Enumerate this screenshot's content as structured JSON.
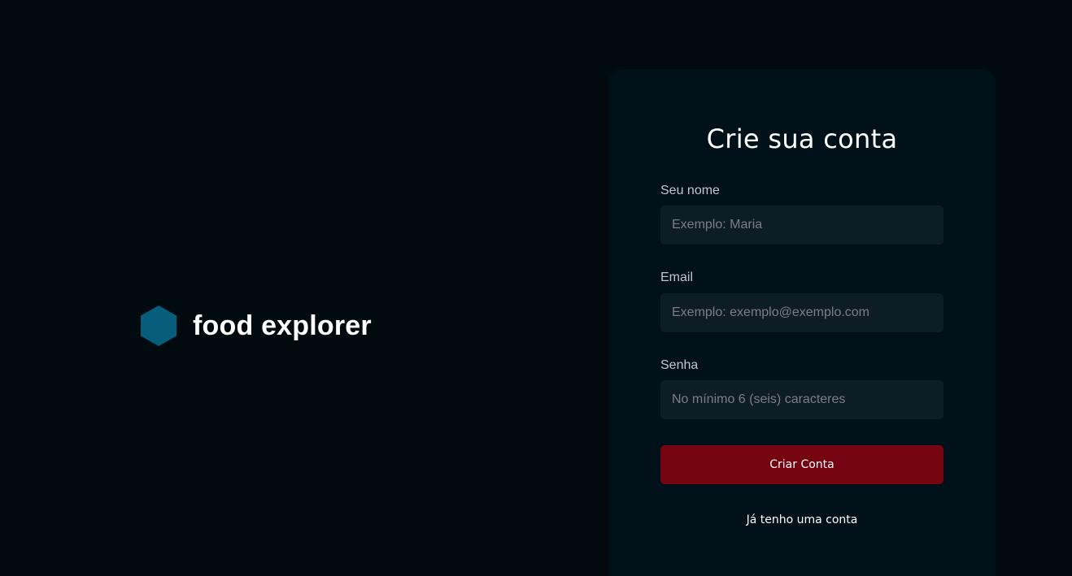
{
  "brand": {
    "name": "food explorer",
    "icon": "hexagon-logo-icon",
    "color": "#065E7C"
  },
  "form": {
    "title": "Crie sua conta",
    "fields": [
      {
        "label": "Seu nome",
        "placeholder": "Exemplo: Maria",
        "value": ""
      },
      {
        "label": "Email",
        "placeholder": "Exemplo: exemplo@exemplo.com",
        "value": ""
      },
      {
        "label": "Senha",
        "placeholder": "No mínimo 6 (seis) caracteres",
        "value": ""
      }
    ],
    "submit_label": "Criar Conta",
    "login_link": "Já tenho uma conta"
  },
  "colors": {
    "background": "#000A0F",
    "panel": "#001119",
    "input": "#0D1D25",
    "accent": "#750310"
  }
}
